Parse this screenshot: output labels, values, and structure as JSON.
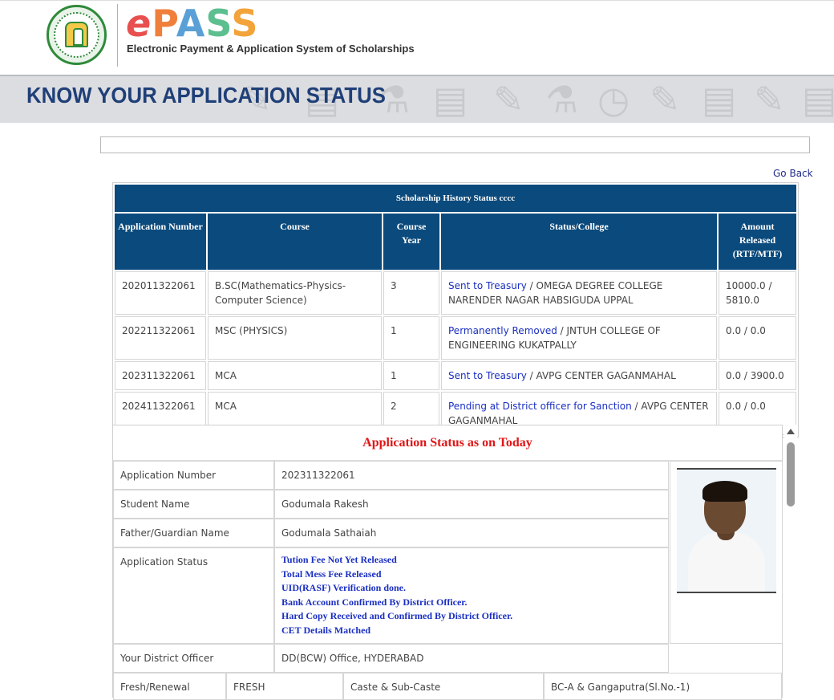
{
  "header": {
    "logo_e": "e",
    "logo_p": "P",
    "logo_a": "A",
    "logo_s1": "S",
    "logo_s2": "S",
    "tagline": "Electronic Payment & Application System of Scholarships",
    "emblem_icon": "telangana-emblem-icon"
  },
  "banner": {
    "title": "KNOW YOUR APPLICATION STATUS"
  },
  "nav": {
    "go_back": "Go Back"
  },
  "history": {
    "caption": "Scholarship History Status cccc",
    "columns": [
      "Application Number",
      "Course",
      "Course Year",
      "Status/College",
      "Amount Released (RTF/MTF)"
    ],
    "rows": [
      {
        "app_no": "202011322061",
        "course": "B.SC(Mathematics-Physics-Computer Science)",
        "year": "3",
        "status": "Sent to Treasury",
        "college": " / OMEGA DEGREE COLLEGE NARENDER NAGAR HABSIGUDA UPPAL",
        "amount": "10000.0 / 5810.0"
      },
      {
        "app_no": "202211322061",
        "course": "MSC (PHYSICS)",
        "year": "1",
        "status": "Permanently Removed",
        "college": " / JNTUH COLLEGE OF ENGINEERING KUKATPALLY",
        "amount": "0.0 / 0.0"
      },
      {
        "app_no": "202311322061",
        "course": "MCA",
        "year": "1",
        "status": "Sent to Treasury",
        "college": " / AVPG CENTER GAGANMAHAL",
        "amount": "0.0 / 3900.0"
      },
      {
        "app_no": "202411322061",
        "course": "MCA",
        "year": "2",
        "status": "Pending at District officer for Sanction",
        "college": " / AVPG CENTER GAGANMAHAL",
        "amount": "0.0 / 0.0"
      }
    ]
  },
  "status_panel": {
    "title": "Application Status as on Today",
    "labels": {
      "app_no": "Application Number",
      "student": "Student Name",
      "father": "Father/Guardian Name",
      "app_status": "Application Status",
      "district_officer": "Your District Officer",
      "fresh_renewal": "Fresh/Renewal",
      "caste": "Caste & Sub-Caste"
    },
    "values": {
      "app_no": "202311322061",
      "student": "Godumala Rakesh",
      "father": "Godumala Sathaiah",
      "status_lines": [
        "Tution Fee Not Yet Released",
        "Total Mess Fee Released",
        "UID(RASF) Verification done.",
        "Bank Account Confirmed By District Officer.",
        "Hard Copy Received and Confirmed By District Officer.",
        "CET Details Matched"
      ],
      "district_officer": "DD(BCW) Office, HYDERABAD",
      "fresh_renewal": "FRESH",
      "caste": "BC-A & Gangaputra(Sl.No.-1)"
    }
  },
  "colors": {
    "header_blue": "#0b4a7c",
    "title_red": "#e01515",
    "link_blue": "#1a2fc2",
    "banner_title": "#1f3f78"
  }
}
